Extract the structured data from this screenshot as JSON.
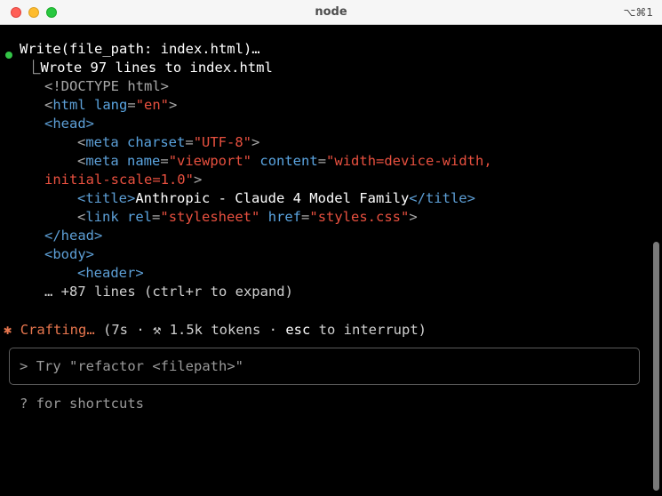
{
  "window": {
    "title": "node",
    "shortcut": "⌥⌘1"
  },
  "terminal": {
    "tool_call": "Write(file_path: index.html)…",
    "result_prefix": "⎿",
    "result": "Wrote 97 lines to index.html",
    "code": {
      "l1": "<!DOCTYPE html>",
      "l2_open": "<",
      "l2_tag": "html",
      "l2_attr": "lang",
      "l2_eq": "=",
      "l2_val": "\"en\"",
      "l2_close": ">",
      "l3": "<head>",
      "l4_open": "<",
      "l4_tag": "meta",
      "l4_attr": "charset",
      "l4_eq": "=",
      "l4_val": "\"UTF-8\"",
      "l4_close": ">",
      "l5_open": "<",
      "l5_tag": "meta",
      "l5_attr1": "name",
      "l5_eq1": "=",
      "l5_val1": "\"viewport\"",
      "l5_attr2": "content",
      "l5_eq2": "=",
      "l5_val2": "\"width=device-width,",
      "l6_val": "initial-scale=1.0\"",
      "l6_close": ">",
      "l7_open": "<title>",
      "l7_text": "Anthropic - Claude 4 Model Family",
      "l7_close": "</title>",
      "l8_open": "<",
      "l8_tag": "link",
      "l8_attr1": "rel",
      "l8_eq1": "=",
      "l8_val1": "\"stylesheet\"",
      "l8_attr2": "href",
      "l8_eq2": "=",
      "l8_val2": "\"styles.css\"",
      "l8_close": ">",
      "l9": "</head>",
      "l10": "<body>",
      "l11": "<header>",
      "more": "… +87 lines (ctrl+r to expand)"
    },
    "status": {
      "icon": "✱",
      "label": "Crafting…",
      "details_open": " (7s · ",
      "tokens_icon": "⚒",
      "tokens": " 1.5k tokens · ",
      "esc": "esc",
      "interrupt": " to interrupt)"
    },
    "prompt": {
      "symbol": ">",
      "placeholder": "Try \"refactor <filepath>\""
    },
    "hint": "? for shortcuts"
  },
  "colors": {
    "background": "#000000",
    "success_dot": "#33c447",
    "status_accent": "#e8764e",
    "tag": "#5d9fd6",
    "string": "#e8503f"
  }
}
